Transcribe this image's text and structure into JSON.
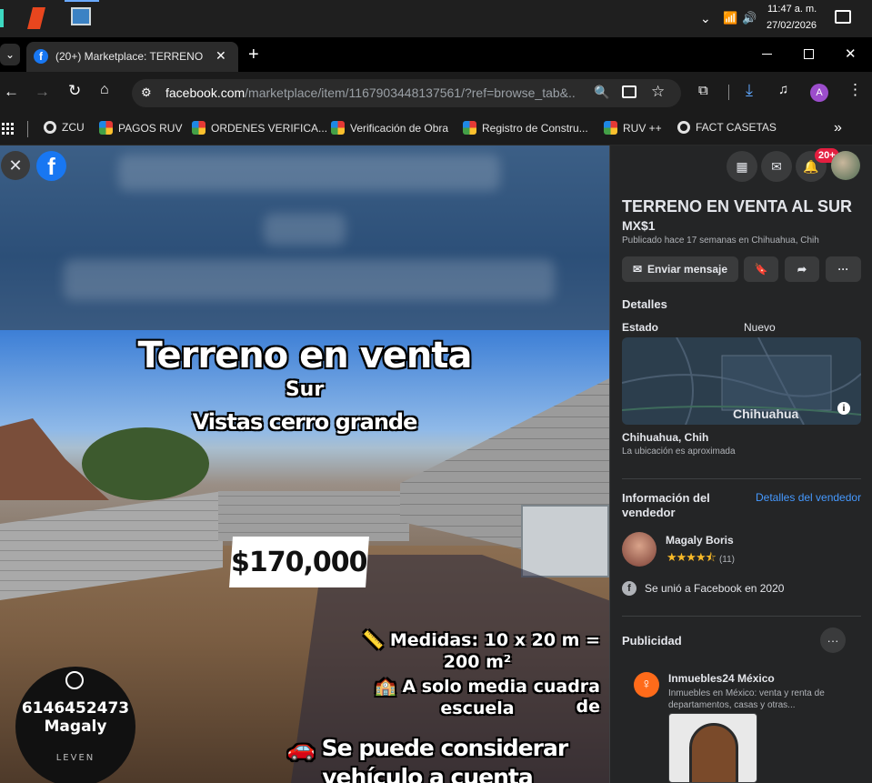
{
  "taskbar": {
    "time": "11:47 a. m.",
    "date": "27/02/2026"
  },
  "browser": {
    "tab_title": "(20+) Marketplace: TERRENO EN VENTA AL SUR",
    "url_host": "facebook.com",
    "url_path": "/marketplace/item/1167903448137561/?ref=browse_tab&...",
    "profile_initial": "A",
    "bookmarks": [
      "ZCU",
      "PAGOS RUV",
      "ORDENES VERIFICA...",
      "Verificación de Obra",
      "Registro de Constru...",
      "RUV ++",
      "FACT CASETAS"
    ]
  },
  "photo": {
    "headline": "Terreno en venta",
    "line2": "Sur",
    "line3": "Vistas cerro grande",
    "price": "$170,000",
    "measures": "📏 Medidas: 10 x 20 m =",
    "measures2": "200 m²",
    "school": "🏫 A solo media cuadra de",
    "school2": "escuela",
    "vehicle": "🚗 Se puede considerar",
    "vehicle2": "vehículo a cuenta",
    "phone": "6146452473",
    "contact_name": "Magaly",
    "brand": "LEVEN"
  },
  "header": {
    "notif_badge": "20+"
  },
  "listing": {
    "title": "TERRENO EN VENTA AL SUR",
    "price": "MX$1",
    "posted": "Publicado hace 17 semanas en Chihuahua, Chih",
    "send_message": "Enviar mensaje",
    "details_heading": "Detalles",
    "condition_label": "Estado",
    "condition_value": "Nuevo",
    "map_label": "Chihuahua",
    "location": "Chihuahua, Chih",
    "location_note": "La ubicación es aproximada"
  },
  "seller": {
    "heading": "Información del vendedor",
    "details_link": "Detalles del vendedor",
    "name": "Magaly Boris",
    "rating_count": "(11)",
    "joined": "Se unió a Facebook en 2020"
  },
  "ads": {
    "heading": "Publicidad",
    "advertiser": "Inmuebles24 México",
    "description": "Inmuebles en México: venta y renta de departamentos, casas y otras..."
  },
  "colors": {
    "accent": "#1877f2",
    "badge": "#e41e3f",
    "link": "#4599ff",
    "star": "#f7b928"
  }
}
